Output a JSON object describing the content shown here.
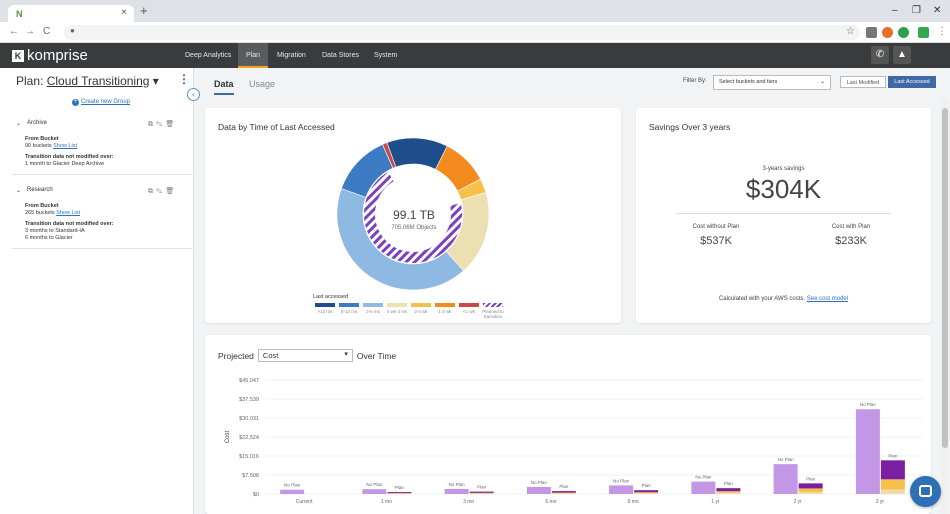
{
  "browser": {
    "tab_favicon": "N",
    "tab_close": "×",
    "new_tab": "+",
    "window_controls": [
      "–",
      "❐",
      "✕"
    ],
    "nav_icons": [
      "←",
      "→",
      "C"
    ],
    "lock_icon": "🔒"
  },
  "appbar": {
    "logo_text": "komprise",
    "logo_mark": "K",
    "nav": [
      {
        "label": "Deep Analytics",
        "active": false
      },
      {
        "label": "Plan",
        "active": true
      },
      {
        "label": "Migration",
        "active": false
      },
      {
        "label": "Data Stores",
        "active": false
      },
      {
        "label": "System",
        "active": false
      }
    ],
    "phone_icon": "✆",
    "bell_icon": "🔔",
    "accent": "#f3a223"
  },
  "sidebar": {
    "plan_prefix": "Plan:",
    "plan_name": "Cloud Transitioning",
    "plan_caret": "▾",
    "menu_icon": "⋮",
    "create_group": "Create new Group",
    "collapse_icon": "‹",
    "groups": [
      {
        "name": "Archive",
        "from_label": "From Bucket",
        "buckets": "90 buckets",
        "show_list": "Show List",
        "transition_label": "Transition data not modified over:",
        "rules": [
          "1 month to Glacier Deep Archive"
        ]
      },
      {
        "name": "Research",
        "from_label": "From Bucket",
        "buckets": "265 buckets",
        "show_list": "Show List",
        "transition_label": "Transition data not modified over:",
        "rules": [
          "3 months to Standard-IA",
          "6 months to Glacier"
        ]
      }
    ]
  },
  "main": {
    "tabs": [
      {
        "label": "Data",
        "active": true
      },
      {
        "label": "Usage",
        "active": false
      }
    ],
    "filter_label": "Filter By:",
    "filter_value": "Select buckets and tiers",
    "toggle_modified": "Last Modified",
    "toggle_accessed": "Last Accessed"
  },
  "donut_card": {
    "title": "Data by Time of Last Accessed",
    "total": "99.1 TB",
    "objects": "705.06M Objects",
    "legend_title": "Last accessed",
    "legend": [
      {
        "label": ">12 ms",
        "color": "#1f4e8c"
      },
      {
        "label": "6-12 ms",
        "color": "#3d7cc4"
      },
      {
        "label": "3-6 ms",
        "color": "#8db9e3"
      },
      {
        "label": "4 wk-3 ms",
        "color": "#ece0b2"
      },
      {
        "label": "2-4 wk",
        "color": "#f6c04a"
      },
      {
        "label": "1-2 wk",
        "color": "#f28a1e"
      },
      {
        "label": "<1 wk",
        "color": "#c94a4a"
      },
      {
        "label": "Planned to transition",
        "color": "#7b3fbf"
      }
    ]
  },
  "chart_data": [
    {
      "type": "pie",
      "title": "Data by Time of Last Accessed",
      "center_text": [
        "99.1 TB",
        "705.06M Objects"
      ],
      "slices": [
        {
          "label": ">12 ms",
          "value": 13
        },
        {
          "label": "6-12 ms",
          "value": 13
        },
        {
          "label": "3-6 ms",
          "value": 42
        },
        {
          "label": "4 wk-3 ms",
          "value": 18
        },
        {
          "label": "2-4 wk",
          "value": 3
        },
        {
          "label": "1-2 wk",
          "value": 10
        },
        {
          "label": "<1 wk",
          "value": 1
        }
      ],
      "planned_to_transition_share": 0.7
    },
    {
      "type": "bar",
      "title": "Projected Cost Over Time",
      "ylabel": "Cost",
      "ylim": [
        0,
        45047
      ],
      "yticks": [
        "$45,047",
        "$37,539",
        "$30,031",
        "$22,524",
        "$15,016",
        "$7,508",
        "$0"
      ],
      "categories": [
        "Current",
        "1 mo",
        "3 mo",
        "6 mo",
        "9 mo",
        "1 yr",
        "2 yr",
        "3 yr"
      ],
      "series": [
        {
          "name": "No Plan",
          "values": [
            1700,
            1900,
            2000,
            2800,
            3400,
            4900,
            11800,
            33500
          ]
        },
        {
          "name": "Plan",
          "stack": [
            {
              "color": "#f1d9a8",
              "values": [
                0,
                150,
                200,
                250,
                300,
                500,
                800,
                1800
              ]
            },
            {
              "color": "#f6c04a",
              "values": [
                0,
                200,
                250,
                300,
                400,
                600,
                1400,
                4000
              ]
            },
            {
              "color": "#7b1fa2",
              "values": [
                0,
                400,
                500,
                600,
                800,
                1200,
                2000,
                7500
              ]
            }
          ]
        }
      ],
      "bar_label_noplan": "No Plan",
      "bar_label_plan": "Plan"
    }
  ],
  "savings": {
    "title": "Savings Over 3 years",
    "label": "3-years savings",
    "amount": "$304K",
    "without_label": "Cost without Plan",
    "without_value": "$537K",
    "with_label": "Cost with Plan",
    "with_value": "$233K",
    "note": "Calculated with your AWS costs.",
    "note_link": "See cost model"
  },
  "projected": {
    "title_prefix": "Projected",
    "select_value": "Cost",
    "title_suffix": "Over Time",
    "caret": "▾"
  }
}
